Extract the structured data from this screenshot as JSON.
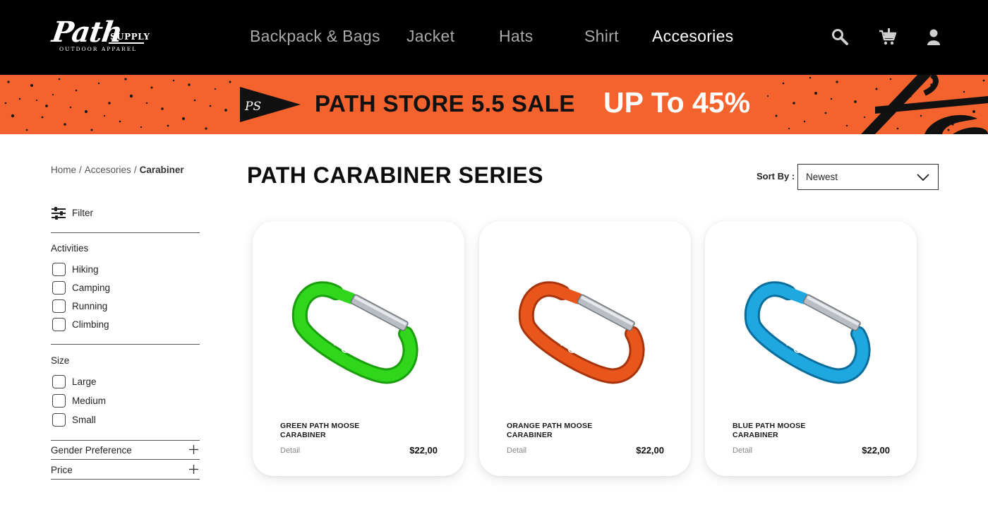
{
  "brand": {
    "logo_script": "Path",
    "logo_supply": "SUPPLY",
    "logo_tagline": "OUTDOOR APPAREL"
  },
  "nav": {
    "items": [
      {
        "label": "Backpack & Bags",
        "active": false
      },
      {
        "label": "Jacket",
        "active": false
      },
      {
        "label": "Hats",
        "active": false
      },
      {
        "label": "Shirt",
        "active": false
      },
      {
        "label": "Accesories",
        "active": true
      }
    ],
    "icons": [
      "search-icon",
      "cart-icon",
      "user-icon"
    ]
  },
  "banner": {
    "badge_text": "PS",
    "sale_text": "PATH STORE 5.5 SALE",
    "discount_text": "UP To 45%",
    "background_color": "#f4622d"
  },
  "breadcrumb": {
    "home": "Home",
    "separator": "/",
    "category": "Accesories",
    "current": "Carabiner"
  },
  "sidebar": {
    "filter_label": "Filter",
    "activities": {
      "title": "Activities",
      "options": [
        "Hiking",
        "Camping",
        "Running",
        "Climbing"
      ]
    },
    "size": {
      "title": "Size",
      "options": [
        "Large",
        "Medium",
        "Small"
      ]
    },
    "gender_label": "Gender Preference",
    "price_label": "Price"
  },
  "main": {
    "title": "PATH CARABINER SERIES",
    "sort_label": "Sort By :",
    "sort_value": "Newest"
  },
  "products": [
    {
      "name": "GREEN PATH MOOSE CARABINER",
      "detail": "Detail",
      "price": "$22,00",
      "color": "#2fd61b",
      "color_dark": "#1a9e0c",
      "image_icon": "green-carabiner"
    },
    {
      "name": "ORANGE PATH MOOSE CARABINER",
      "detail": "Detail",
      "price": "$22,00",
      "color": "#e8561c",
      "color_dark": "#a8340c",
      "image_icon": "orange-carabiner"
    },
    {
      "name": "BLUE PATH MOOSE CARABINER",
      "detail": "Detail",
      "price": "$22,00",
      "color": "#1fa8e0",
      "color_dark": "#0a6d9c",
      "image_icon": "blue-carabiner"
    }
  ]
}
